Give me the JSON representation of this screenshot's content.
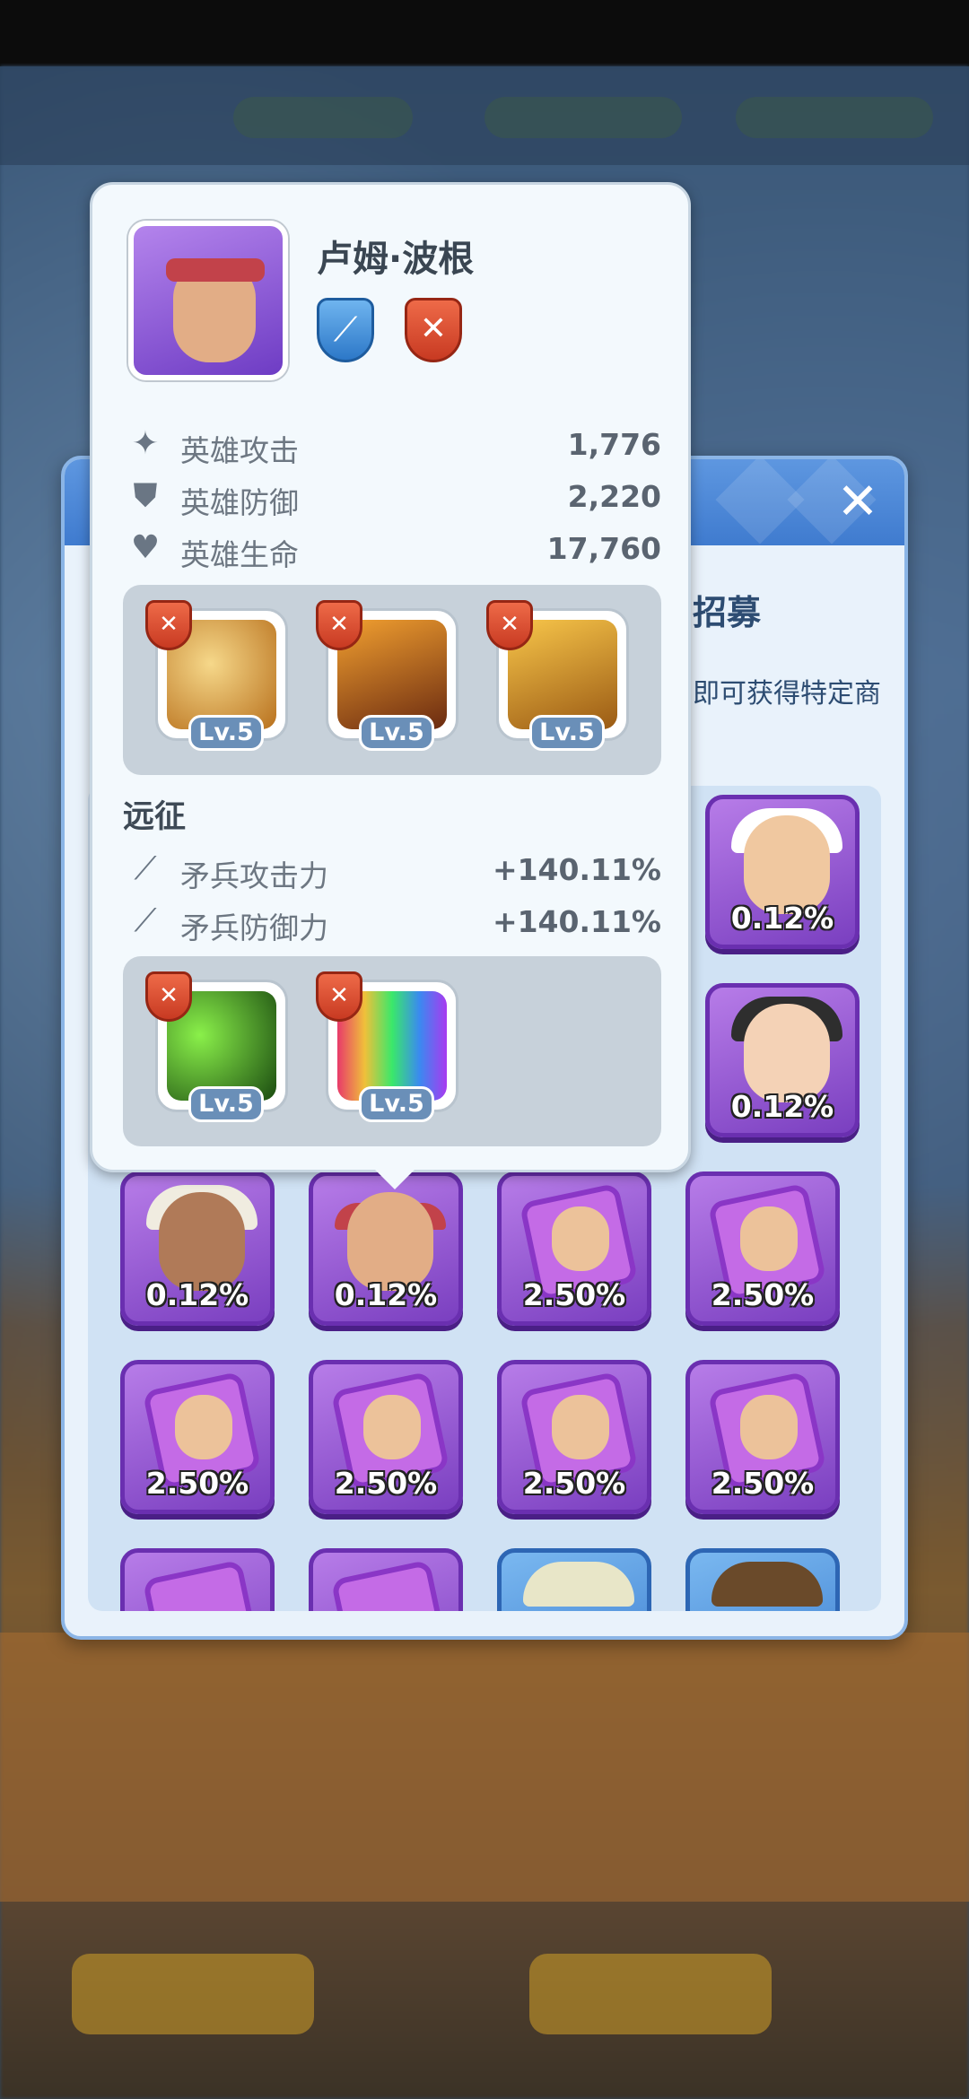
{
  "hero": {
    "name": "卢姆·波根",
    "type_icon": "spear-icon",
    "role_icon": "crossed-swords-icon",
    "stats": [
      {
        "icon": "sword-icon",
        "label": "英雄攻击",
        "value": "1,776"
      },
      {
        "icon": "shield-icon",
        "label": "英雄防御",
        "value": "2,220"
      },
      {
        "icon": "heart-icon",
        "label": "英雄生命",
        "value": "17,760"
      }
    ],
    "skills_top": [
      {
        "name": "skill-whirlwind",
        "level": "Lv.5"
      },
      {
        "name": "skill-slash",
        "level": "Lv.5"
      },
      {
        "name": "skill-spear-throw",
        "level": "Lv.5"
      }
    ],
    "section_title": "远征",
    "bonuses": [
      {
        "icon": "spear-icon",
        "label": "矛兵攻击力",
        "value": "+140.11%"
      },
      {
        "icon": "spear-icon",
        "label": "矛兵防御力",
        "value": "+140.11%"
      }
    ],
    "skills_bottom": [
      {
        "name": "skill-green-strike",
        "level": "Lv.5"
      },
      {
        "name": "skill-rainbow-hammer",
        "level": "Lv.5"
      }
    ]
  },
  "panel": {
    "title": "招募",
    "description": "即可获得特定商",
    "close_icon": "close-icon"
  },
  "grid": {
    "cards": [
      {
        "pct": "0.12%",
        "kind": "hero",
        "colors": {
          "skin": "#f0c8a0",
          "hat": "#ffffff"
        }
      },
      {
        "pct": "0.12%",
        "kind": "hero",
        "colors": {
          "skin": "#f4d2b6",
          "hat": "#2e2e2e"
        }
      },
      {
        "pct": "0.12%",
        "kind": "hero",
        "colors": {
          "skin": "#b07a58",
          "hat": "#f0ece0"
        }
      },
      {
        "pct": "0.12%",
        "kind": "hero",
        "colors": {
          "skin": "#e2ad86",
          "hat": "#c2424a"
        }
      },
      {
        "pct": "2.50%",
        "kind": "shard"
      },
      {
        "pct": "2.50%",
        "kind": "shard"
      },
      {
        "pct": "2.50%",
        "kind": "shard"
      },
      {
        "pct": "2.50%",
        "kind": "shard"
      },
      {
        "pct": "2.50%",
        "kind": "shard"
      },
      {
        "pct": "2.50%",
        "kind": "shard"
      }
    ]
  }
}
